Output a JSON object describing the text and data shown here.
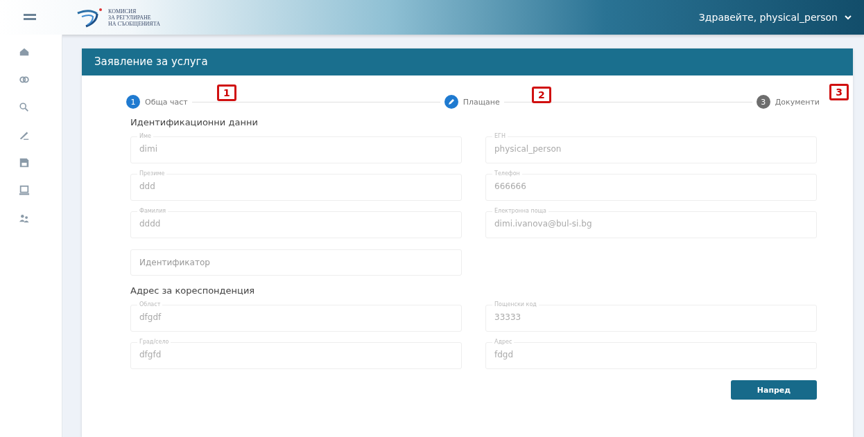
{
  "header": {
    "logo_lines": [
      "КОМИСИЯ",
      "ЗА РЕГУЛИРАНЕ",
      "НА СЪОБЩЕНИЯТА"
    ],
    "greeting": "Здравейте, physical_person"
  },
  "card": {
    "title": "Заявление за услуга",
    "steps": [
      {
        "number": "1",
        "label": "Обща част",
        "active": true,
        "editing": false,
        "callout": "1"
      },
      {
        "label": "Плащане",
        "active": true,
        "editing": true,
        "callout": "2"
      },
      {
        "number": "3",
        "label": "Документи",
        "active": false,
        "editing": false,
        "callout": "3"
      }
    ],
    "sections": [
      {
        "title": "Идентификационни данни",
        "fields": [
          {
            "label": "Име",
            "value": "dimi",
            "disabled": true
          },
          {
            "label": "ЕГН",
            "value": "physical_person",
            "disabled": true
          },
          {
            "label": "Презиме",
            "value": "ddd",
            "disabled": true
          },
          {
            "label": "Телефон",
            "value": "666666",
            "disabled": true
          },
          {
            "label": "Фамилия",
            "value": "dddd",
            "disabled": true
          },
          {
            "label": "Електронна поща",
            "value": "dimi.ivanova@bul-si.bg",
            "disabled": true
          },
          {
            "placeholder": "Идентификатор",
            "disabled": false
          }
        ]
      },
      {
        "title": "Адрес за кореспонденция",
        "fields": [
          {
            "label": "Област",
            "value": "dfgdf",
            "disabled": true
          },
          {
            "label": "Пощенски код",
            "value": "33333",
            "disabled": true
          },
          {
            "label": "Град/село",
            "value": "dfgfd",
            "disabled": true
          },
          {
            "label": "Адрес",
            "value": "fdgd",
            "disabled": true
          }
        ]
      }
    ],
    "next_button": "Напред"
  }
}
